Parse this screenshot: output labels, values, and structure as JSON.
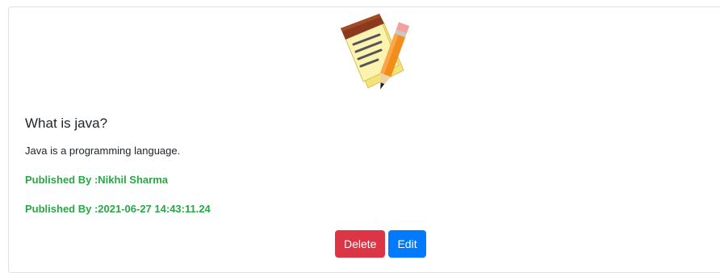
{
  "note": {
    "image_icon": "notepad-with-pencil-icon",
    "title": "What is java?",
    "content": "Java is a programming language.",
    "author_line": "Published By :Nikhil Sharma",
    "date_line": "Published By :2021-06-27 14:43:11.24"
  },
  "actions": {
    "delete_label": "Delete",
    "edit_label": "Edit"
  },
  "colors": {
    "danger": "#dc3545",
    "primary": "#007bff",
    "success_text": "#28a745"
  }
}
